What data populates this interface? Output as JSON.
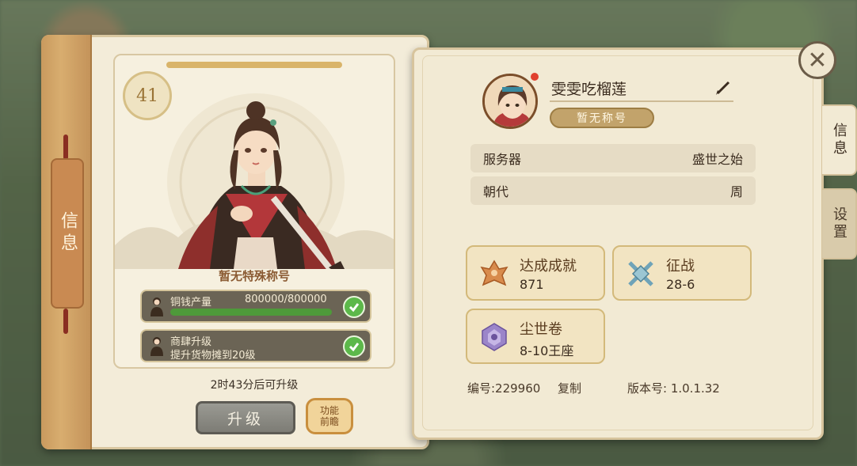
{
  "left": {
    "spine_tab": "信息",
    "level": "41",
    "special_title": "暂无特殊称号",
    "tasks": [
      {
        "label": "铜钱产量",
        "progress": "800000/800000",
        "fill": 1.0
      },
      {
        "label_line1": "商肆升级",
        "label_line2": "提升货物摊到20级"
      }
    ],
    "upgrade_time": "2时43分后可升级",
    "upgrade_button": "升级",
    "preview_button_line1": "功能",
    "preview_button_line2": "前瞻"
  },
  "right": {
    "player_name": "雯雯吃榴莲",
    "title_badge": "暂无称号",
    "rows": [
      {
        "label": "服务器",
        "value": "盛世之始"
      },
      {
        "label": "朝代",
        "value": "周"
      }
    ],
    "stats": [
      {
        "title": "达成成就",
        "value": "871",
        "icon": "phoenix-icon"
      },
      {
        "title": "征战",
        "value": "28-6",
        "icon": "crossed-swords-icon"
      },
      {
        "title": "尘世卷",
        "value": "8-10王座",
        "icon": "crest-icon"
      }
    ],
    "id_label": "编号:229960",
    "copy_label": "复制",
    "version_label": "版本号: 1.0.1.32",
    "side_tabs": [
      "信息",
      "设置"
    ]
  },
  "colors": {
    "accent": "#c2a36b",
    "check": "#5cb84a"
  }
}
